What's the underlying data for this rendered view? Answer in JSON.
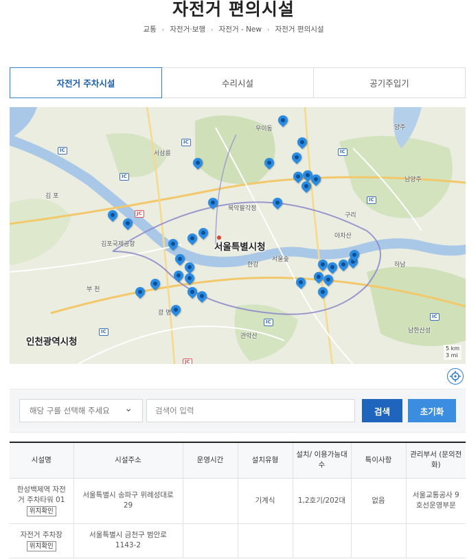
{
  "page": {
    "title": "자전거 편의시설"
  },
  "breadcrumb": [
    "교통",
    "자전거·보행",
    "자전거 - New",
    "자전거 편의시설"
  ],
  "tabs": [
    {
      "label": "자전거 주차시설",
      "active": true
    },
    {
      "label": "수리시설",
      "active": false
    },
    {
      "label": "공기주입기",
      "active": false
    }
  ],
  "map": {
    "labels": {
      "seoul_city_hall": "서울특별시청",
      "incheon_city_hall": "인천광역시청",
      "seosan": "서삼릉",
      "gimpo": "김 포",
      "gwangmyeong": "광 명",
      "bucheon": "부 천",
      "guri": "구리",
      "namyangju": "남양주",
      "hanam": "하남",
      "gimpo_airport": "김포국제공항",
      "bukhan": "북악팔각정",
      "acha": "아차산",
      "ui_dong": "우이동",
      "yangju": "양주",
      "seoul_forest": "서울숲",
      "hangang": "한강",
      "seongnam": "남한산성",
      "gwanak": "관악산"
    },
    "scale": [
      "5 km",
      "3 mi"
    ],
    "ic": "IC",
    "jc": "JC"
  },
  "search": {
    "district_placeholder": "해당 구를 선택해 주세요",
    "keyword_placeholder": "검색어 입력",
    "search_label": "검색",
    "reset_label": "초기화",
    "chevron": "⌄"
  },
  "table": {
    "headers": [
      "시설명",
      "시설주소",
      "운영시간",
      "설치유형",
      "설치/ 이용가능대수",
      "특이사항",
      "관리부서 (문의전화)"
    ],
    "location_label": "위치확인",
    "rows": [
      {
        "name": "한성백제역 자전거 주차타워 01",
        "address": "서울특별시 송파구 위례성대로 29",
        "hours": "",
        "type": "기계식",
        "capacity": "1,2호기/202대",
        "notes": "없음",
        "dept": "서울교통공사 9호선운영부문"
      },
      {
        "name": "자전거 주차장",
        "address": "서울특별시 금천구 범안로 1143-2",
        "hours": "",
        "type": "",
        "capacity": "",
        "notes": "",
        "dept": ""
      }
    ]
  }
}
